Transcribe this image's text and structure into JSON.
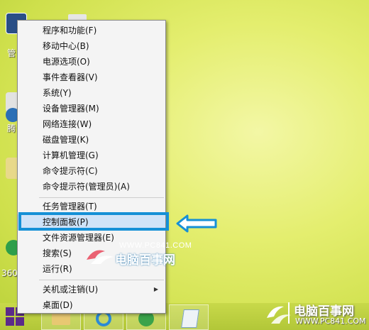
{
  "desktop": {
    "icons": [
      {
        "label": "管",
        "icon": "app-icon"
      },
      {
        "label": "",
        "icon": "app-icon"
      },
      {
        "label": "腾",
        "icon": "tencent-icon"
      },
      {
        "label": "",
        "icon": "folder-icon"
      },
      {
        "label": "360",
        "icon": "360-icon"
      }
    ]
  },
  "context_menu": {
    "items": [
      "程序和功能(F)",
      "移动中心(B)",
      "电源选项(O)",
      "事件查看器(V)",
      "系统(Y)",
      "设备管理器(M)",
      "网络连接(W)",
      "磁盘管理(K)",
      "计算机管理(G)",
      "命令提示符(C)",
      "命令提示符(管理员)(A)",
      "任务管理器(T)",
      "控制面板(P)",
      "文件资源管理器(E)",
      "搜索(S)",
      "运行(R)",
      "关机或注销(U)",
      "桌面(D)"
    ],
    "highlighted_item": "控制面板(P)",
    "submenu_arrow": "▶"
  },
  "watermark": {
    "url": "WWW.PC841.COM",
    "name": "电脑百事网"
  },
  "brand": {
    "name": "电脑百事网",
    "url": "WWW.PC841.COM"
  },
  "colors": {
    "highlight_border": "#1590d6",
    "arrow": "#1590d6",
    "desktop": "#d8e65a"
  }
}
